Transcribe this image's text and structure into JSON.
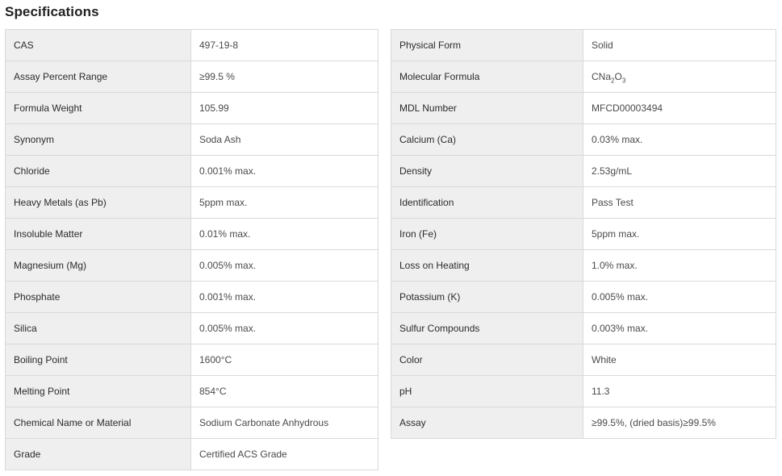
{
  "section_title": "Specifications",
  "left_table": [
    {
      "label": "CAS",
      "value": "497-19-8"
    },
    {
      "label": "Assay Percent Range",
      "value": "≥99.5 %"
    },
    {
      "label": "Formula Weight",
      "value": "105.99"
    },
    {
      "label": "Synonym",
      "value": "Soda Ash"
    },
    {
      "label": "Chloride",
      "value": "0.001% max."
    },
    {
      "label": "Heavy Metals (as Pb)",
      "value": "5ppm max."
    },
    {
      "label": "Insoluble Matter",
      "value": "0.01% max."
    },
    {
      "label": "Magnesium (Mg)",
      "value": "0.005% max."
    },
    {
      "label": "Phosphate",
      "value": "0.001% max."
    },
    {
      "label": "Silica",
      "value": "0.005% max."
    },
    {
      "label": "Boiling Point",
      "value": "1600°C"
    },
    {
      "label": "Melting Point",
      "value": "854°C"
    },
    {
      "label": "Chemical Name or Material",
      "value": "Sodium Carbonate Anhydrous"
    },
    {
      "label": "Grade",
      "value": "Certified ACS Grade"
    }
  ],
  "right_table": [
    {
      "label": "Physical Form",
      "value": "Solid"
    },
    {
      "label": "Molecular Formula",
      "value": "",
      "formula": {
        "a": "CNa",
        "a_sub": "2",
        "b": "O",
        "b_sub": "3"
      }
    },
    {
      "label": "MDL Number",
      "value": "MFCD00003494"
    },
    {
      "label": "Calcium (Ca)",
      "value": "0.03% max."
    },
    {
      "label": "Density",
      "value": "2.53g/mL"
    },
    {
      "label": "Identification",
      "value": "Pass Test"
    },
    {
      "label": "Iron (Fe)",
      "value": "5ppm max."
    },
    {
      "label": "Loss on Heating",
      "value": "1.0% max."
    },
    {
      "label": "Potassium (K)",
      "value": "0.005% max."
    },
    {
      "label": "Sulfur Compounds",
      "value": "0.003% max."
    },
    {
      "label": "Color",
      "value": "White"
    },
    {
      "label": "pH",
      "value": "11.3"
    },
    {
      "label": "Assay",
      "value": "≥99.5%, (dried basis)≥99.5%"
    }
  ]
}
